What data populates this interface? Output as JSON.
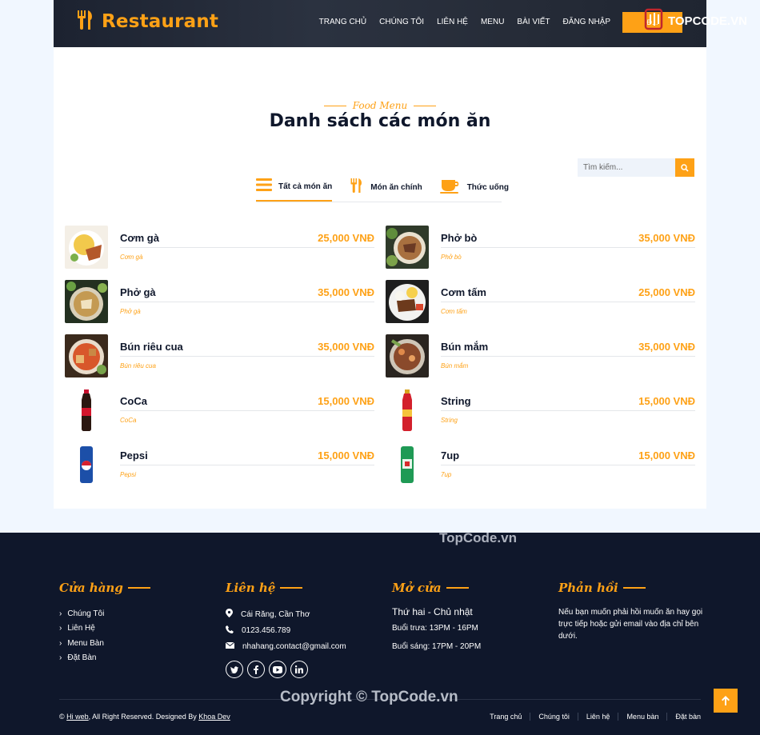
{
  "brand": {
    "name": "Restaurant"
  },
  "nav": {
    "items": [
      "TRANG CHỦ",
      "CHÚNG TÔI",
      "LIÊN HỆ",
      "MENU",
      "BÀI VIẾT",
      "ĐĂNG NHẬP"
    ],
    "cta": "Đ..."
  },
  "watermark": {
    "top": "TOPCODE.VN",
    "middle": "TopCode.vn",
    "copyright": "Copyright © TopCode.vn"
  },
  "section": {
    "subtitle": "Food Menu",
    "title": "Danh sách các món ăn"
  },
  "search": {
    "placeholder": "Tìm kiếm..."
  },
  "tabs": [
    {
      "label": "Tất cả món ăn",
      "icon": "list-icon",
      "active": true
    },
    {
      "label": "Món ăn chính",
      "icon": "utensils-icon",
      "active": false
    },
    {
      "label": "Thức uống",
      "icon": "coffee-icon",
      "active": false
    }
  ],
  "menu": [
    {
      "name": "Cơm gà",
      "price": "25,000 VNĐ",
      "desc": "Cơm gà",
      "image": "rice-chicken"
    },
    {
      "name": "Phở bò",
      "price": "35,000 VNĐ",
      "desc": "Phở bò",
      "image": "pho-beef"
    },
    {
      "name": "Phở gà",
      "price": "35,000 VNĐ",
      "desc": "Phở gà",
      "image": "pho-chicken"
    },
    {
      "name": "Cơm tấm",
      "price": "25,000 VNĐ",
      "desc": "Cơm tấm",
      "image": "broken-rice"
    },
    {
      "name": "Bún riêu cua",
      "price": "35,000 VNĐ",
      "desc": "Bún riêu cua",
      "image": "crab-noodle"
    },
    {
      "name": "Bún mắm",
      "price": "35,000 VNĐ",
      "desc": "Bún mắm",
      "image": "fish-noodle"
    },
    {
      "name": "CoCa",
      "price": "15,000 VNĐ",
      "desc": "CoCa",
      "image": "coke-bottle"
    },
    {
      "name": "String",
      "price": "15,000 VNĐ",
      "desc": "String",
      "image": "sting-bottle"
    },
    {
      "name": "Pepsi",
      "price": "15,000 VNĐ",
      "desc": "Pepsi",
      "image": "pepsi-can"
    },
    {
      "name": "7up",
      "price": "15,000 VNĐ",
      "desc": "7up",
      "image": "7up-can"
    }
  ],
  "footer": {
    "store": {
      "title": "Cửa hàng",
      "links": [
        "Chúng Tôi",
        "Liên Hệ",
        "Menu Bàn",
        "Đặt Bàn"
      ]
    },
    "contact": {
      "title": "Liên hệ",
      "address": "Cái Răng, Cần Thơ",
      "phone": "0123.456.789",
      "email": "nhahang.contact@gmail.com"
    },
    "open": {
      "title": "Mở cửa",
      "days": "Thứ hai - Chủ nhật",
      "lunch": "Buổi trưa: 13PM - 16PM",
      "morning": "Buổi sáng: 17PM - 20PM"
    },
    "feedback": {
      "title": "Phản hồi",
      "text": "Nếu bạn muốn phải hồi muốn ăn hay gọi trực tiếp hoặc gửi email vào địa chỉ bên dưới."
    },
    "copyright": {
      "prefix": "©",
      "site": "Hi web",
      "middle": ", All Right Reserved. Designed By",
      "author": "Khoa Dev"
    },
    "links": [
      "Trang chủ",
      "Chúng tôi",
      "Liên hệ",
      "Menu bàn",
      "Đặt bàn"
    ]
  },
  "colors": {
    "accent": "#fea116",
    "dark": "#0f172b"
  }
}
